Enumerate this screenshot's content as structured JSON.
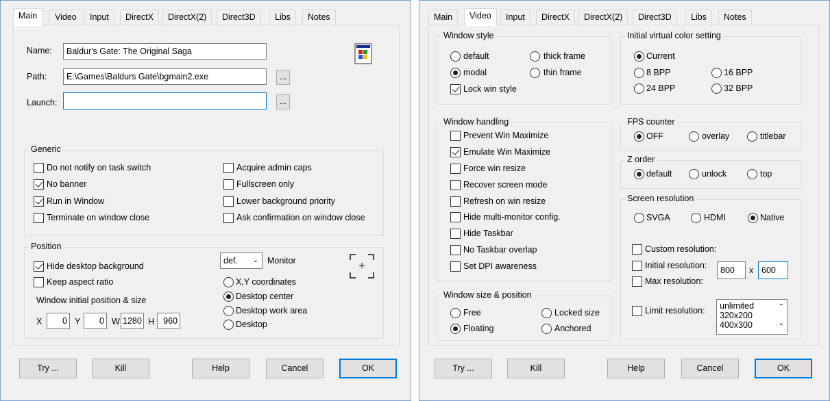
{
  "left_dialog": {
    "tabs": [
      "Main",
      "Video",
      "Input",
      "DirectX",
      "DirectX(2)",
      "Direct3D",
      "Libs",
      "Notes"
    ],
    "active_tab": "Main",
    "name_label": "Name:",
    "name_value": "Baldur's Gate: The Original Saga",
    "path_label": "Path:",
    "path_value": "E:\\Games\\Baldurs Gate\\bgmain2.exe",
    "launch_label": "Launch:",
    "launch_value": "",
    "browse_label": "...",
    "generic": {
      "title": "Generic",
      "items": [
        {
          "label": "Do not notify on task switch",
          "checked": false
        },
        {
          "label": "No banner",
          "checked": true
        },
        {
          "label": "Run in Window",
          "checked": true
        },
        {
          "label": "Terminate on window close",
          "checked": false
        },
        {
          "label": "Acquire admin caps",
          "checked": false
        },
        {
          "label": "Fullscreen only",
          "checked": false
        },
        {
          "label": "Lower background priority",
          "checked": false
        },
        {
          "label": "Ask confirmation on window close",
          "checked": false
        }
      ]
    },
    "position": {
      "title": "Position",
      "hide_desktop": "Hide desktop background",
      "keep_aspect": "Keep aspect ratio",
      "initial_label": "Window initial position & size",
      "x_label": "X",
      "x_value": "0",
      "y_label": "Y",
      "y_value": "0",
      "w_label": "W",
      "w_value": "1280",
      "h_label": "H",
      "h_value": "960",
      "monitor_value": "def.",
      "monitor_label": "Monitor",
      "radios": [
        {
          "label": "X,Y coordinates",
          "checked": false
        },
        {
          "label": "Desktop center",
          "checked": true
        },
        {
          "label": "Desktop work area",
          "checked": false
        },
        {
          "label": "Desktop",
          "checked": false
        }
      ]
    },
    "buttons": {
      "try": "Try ...",
      "kill": "Kill",
      "help": "Help",
      "cancel": "Cancel",
      "ok": "OK"
    }
  },
  "right_dialog": {
    "tabs": [
      "Main",
      "Video",
      "Input",
      "DirectX",
      "DirectX(2)",
      "Direct3D",
      "Libs",
      "Notes"
    ],
    "active_tab": "Video",
    "window_style": {
      "title": "Window style",
      "default": "default",
      "thick_frame": "thick frame",
      "modal": "modal",
      "thin_frame": "thin frame",
      "lock": "Lock win style"
    },
    "color": {
      "title": "Initial virtual color setting",
      "current": "Current",
      "bpp8": "8 BPP",
      "bpp16": "16 BPP",
      "bpp24": "24 BPP",
      "bpp32": "32 BPP"
    },
    "handling": {
      "title": "Window handling",
      "items": [
        {
          "label": "Prevent Win Maximize",
          "checked": false
        },
        {
          "label": "Emulate Win Maximize",
          "checked": true
        },
        {
          "label": "Force win resize",
          "checked": false
        },
        {
          "label": "Recover screen mode",
          "checked": false
        },
        {
          "label": "Refresh on win resize",
          "checked": false
        },
        {
          "label": "Hide multi-monitor config.",
          "checked": false
        },
        {
          "label": "Hide Taskbar",
          "checked": false
        },
        {
          "label": "No Taskbar overlap",
          "checked": false
        },
        {
          "label": "Set DPI awareness",
          "checked": false
        }
      ]
    },
    "fps": {
      "title": "FPS counter",
      "off": "OFF",
      "overlay": "overlay",
      "titlebar": "titlebar"
    },
    "zorder": {
      "title": "Z order",
      "default": "default",
      "unlock": "unlock",
      "top": "top"
    },
    "resolution": {
      "title": "Screen resolution",
      "svga": "SVGA",
      "hdmi": "HDMI",
      "native": "Native",
      "custom": "Custom resolution:",
      "initial": "Initial resolution:",
      "init_w": "800",
      "x_sep": "x",
      "init_h": "600",
      "max": "Max resolution:",
      "limit": "Limit  resolution:",
      "list": [
        "unlimited",
        "320x200",
        "400x300"
      ]
    },
    "size_pos": {
      "title": "Window size & position",
      "free": "Free",
      "locked": "Locked size",
      "floating": "Floating",
      "anchored": "Anchored"
    },
    "buttons": {
      "try": "Try ...",
      "kill": "Kill",
      "help": "Help",
      "cancel": "Cancel",
      "ok": "OK"
    }
  }
}
